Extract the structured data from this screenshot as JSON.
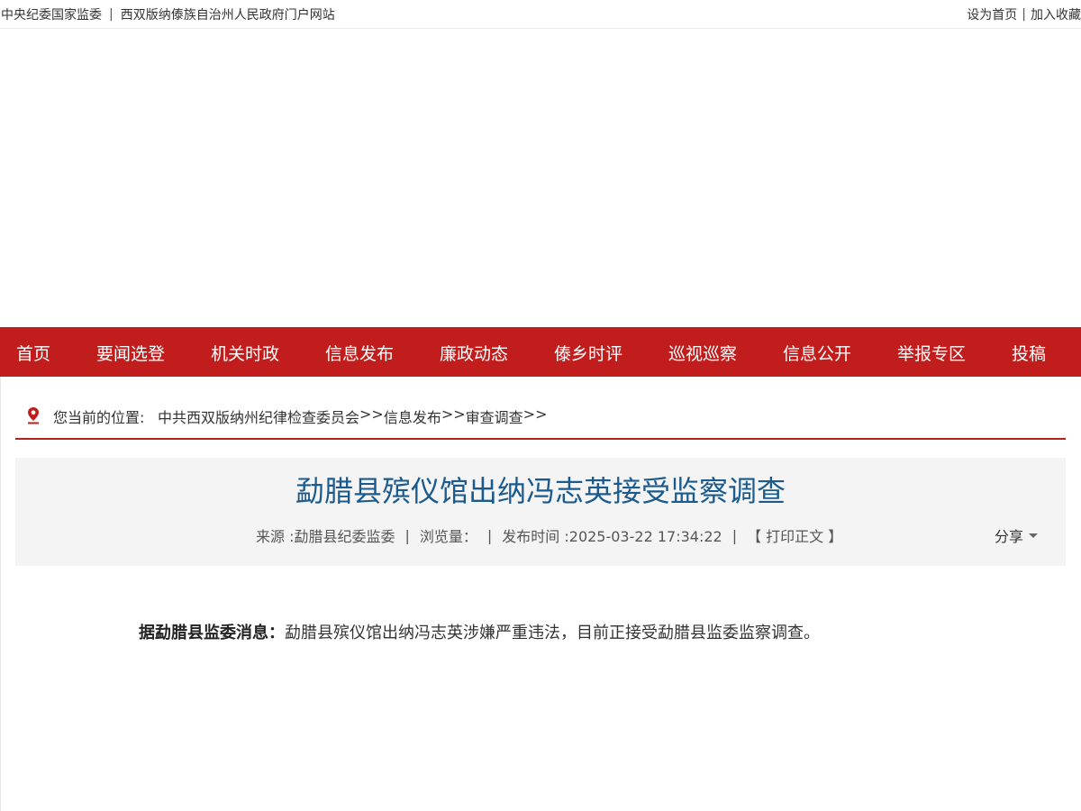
{
  "topbar": {
    "link1": "中央纪委国家监委",
    "sep": "|",
    "link2": "西双版纳傣族自治州人民政府门户网站",
    "set_home": "设为首页",
    "sep2": "|",
    "favorite": "加入收藏"
  },
  "nav": {
    "items": [
      "首页",
      "要闻选登",
      "机关时政",
      "信息发布",
      "廉政动态",
      "傣乡时评",
      "巡视巡察",
      "信息公开",
      "举报专区",
      "投稿"
    ]
  },
  "breadcrumb": {
    "label": "您当前的位置:",
    "path": [
      "中共西双版纳州纪律检查委员会",
      ">>",
      "信息发布",
      ">>",
      "审查调查",
      ">>"
    ]
  },
  "article": {
    "title": "勐腊县殡仪馆出纳冯志英接受监察调查",
    "source": "来源 :勐腊县纪委监委",
    "views": "浏览量：",
    "sep": "|",
    "publish_time": "发布时间 :2025-03-22 17:34:22",
    "print": "【 打印正文 】",
    "share": "分享",
    "lead": "据勐腊县监委消息：",
    "body": "勐腊县殡仪馆出纳冯志英涉嫌严重违法，目前正接受勐腊县监委监察调查。"
  },
  "colors": {
    "nav_bg": "#c21d1d",
    "title": "#1b5a8c",
    "pin": "#c21d1d"
  }
}
